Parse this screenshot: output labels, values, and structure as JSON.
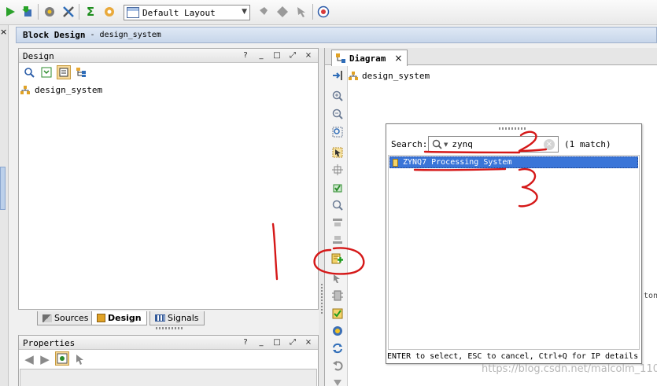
{
  "toolbar": {
    "layout_select": "Default Layout",
    "icons": [
      "run-icon",
      "program-device-icon",
      "settings-icon",
      "tools-icon",
      "sigma-icon",
      "ip-catalog-icon",
      "layout-icon",
      "pin-icon",
      "diamond-icon",
      "pointer-icon",
      "help-icon"
    ]
  },
  "left_edge": {
    "close_glyph": "×"
  },
  "header": {
    "title": "Block Design",
    "subtitle": "- design_system"
  },
  "design_panel": {
    "title": "Design",
    "controls": [
      "?",
      "_",
      "□",
      "⤢",
      "×"
    ],
    "tree": [
      {
        "label": "design_system",
        "icon": "hierarchy-icon"
      }
    ],
    "tabs": [
      {
        "label": "Sources",
        "icon": "sources-icon",
        "active": false
      },
      {
        "label": "Design",
        "icon": "design-icon",
        "active": true
      },
      {
        "label": "Signals",
        "icon": "signals-icon",
        "active": false
      }
    ]
  },
  "properties_panel": {
    "title": "Properties",
    "controls": [
      "?",
      "_",
      "□",
      "⤢",
      "×"
    ]
  },
  "diagram": {
    "tab_label": "Diagram",
    "close_glyph": "×",
    "breadcrumb": "design_system",
    "edge_text": "ton",
    "watermark": "https://blog.csdn.net/malcolm_110",
    "annotations": [
      "1",
      "2",
      "3"
    ]
  },
  "search_popup": {
    "search_label": "Search:",
    "query": "zynq",
    "match_count": "(1 match)",
    "results": [
      {
        "label": "ZYNQ7 Processing System",
        "selected": true
      }
    ],
    "footer_hint": "ENTER to select, ESC to cancel, Ctrl+Q for IP details"
  }
}
